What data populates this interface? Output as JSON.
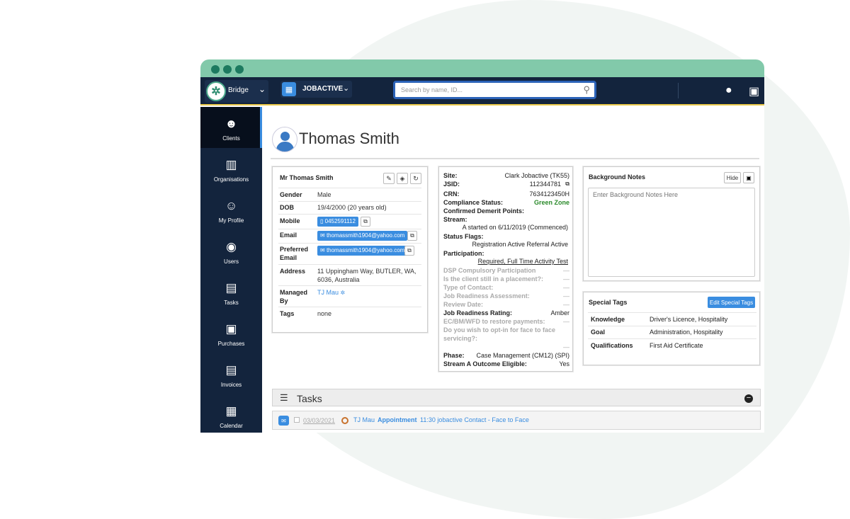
{
  "colors": {
    "titlebar": "#82c9aa",
    "nav": "#13243d",
    "accent": "#3a8de0",
    "green_zone": "#2a8a2a"
  },
  "app": {
    "brand": "Bridge",
    "program": "JOBACTIVE",
    "search_placeholder": "Search by name, ID..."
  },
  "sidebar": {
    "items": [
      {
        "label": "Clients",
        "icon": "clients-icon"
      },
      {
        "label": "Organisations",
        "icon": "building-icon"
      },
      {
        "label": "My Profile",
        "icon": "profile-icon"
      },
      {
        "label": "Users",
        "icon": "users-icon"
      },
      {
        "label": "Tasks",
        "icon": "tasks-icon"
      },
      {
        "label": "Purchases",
        "icon": "money-icon"
      },
      {
        "label": "Invoices",
        "icon": "invoice-icon"
      },
      {
        "label": "Calendar",
        "icon": "calendar-icon"
      }
    ]
  },
  "client": {
    "name": "Thomas Smith",
    "full_name": "Mr Thomas Smith",
    "details": {
      "gender_label": "Gender",
      "gender": "Male",
      "dob_label": "DOB",
      "dob": "19/4/2000 (20 years old)",
      "mobile_label": "Mobile",
      "mobile": "0452591112",
      "email_label": "Email",
      "email": "thomassmith1904@yahoo.com",
      "preferred_email_label_1": "Preferred",
      "preferred_email_label_2": "Email",
      "preferred_email": "thomassmith1904@yahoo.com",
      "address_label": "Address",
      "address_1": "11 Uppingham Way, BUTLER, WA,",
      "address_2": "6036, Australia",
      "managed_label_1": "Managed",
      "managed_label_2": "By",
      "managed_by": "TJ Mau",
      "tags_label": "Tags",
      "tags": "none"
    }
  },
  "jobactive": {
    "site_label": "Site:",
    "site": "Clark Jobactive (TK55)",
    "jsid_label": "JSID:",
    "jsid": "112344781",
    "crn_label": "CRN:",
    "crn": "7634123450H",
    "compliance_label": "Compliance Status:",
    "compliance": "Green Zone",
    "demerit_label": "Confirmed Demerit Points:",
    "stream_label": "Stream:",
    "stream": "A started on 6/11/2019 (Commenced)",
    "flags_label": "Status Flags:",
    "flags": "Registration Active Referral Active",
    "participation_label": "Participation:",
    "participation": "Required, Full Time Activity Test",
    "dsp_label": "DSP Compulsory Participation",
    "dsp": "—",
    "placement_label": "Is the client still in a placement?:",
    "placement": "—",
    "contact_label": "Type of Contact:",
    "contact": "—",
    "jra_label": "Job Readiness Assessment:",
    "jra": "—",
    "review_label": "Review Date:",
    "review": "—",
    "jrr_label": "Job Readiness Rating:",
    "jrr": "Amber",
    "ec_label": "EC/BM/WFD to restore payments:",
    "ec": "—",
    "optin_label_1": "Do you wish to opt-in for face to face",
    "optin_label_2": "servicing?:",
    "optin": "—",
    "phase_label": "Phase:",
    "phase": "Case Management (CM12) (SPI)",
    "outcome_label": "Stream A Outcome Eligible:",
    "outcome": "Yes"
  },
  "background_notes": {
    "title": "Background Notes",
    "hide_label": "Hide",
    "placeholder": "Enter Background Notes Here"
  },
  "special_tags": {
    "title": "Special Tags",
    "edit_label": "Edit Special Tags",
    "rows": [
      {
        "key": "Knowledge",
        "value": "Driver's Licence, Hospitality"
      },
      {
        "key": "Goal",
        "value": "Administration, Hospitality"
      },
      {
        "key": "Qualifications",
        "value": "First Aid Certificate"
      }
    ]
  },
  "tasks": {
    "title": "Tasks",
    "rows": [
      {
        "date": "03/03/2021",
        "user": "TJ Mau",
        "type": "Appointment",
        "description": "11:30 jobactive Contact - Face to Face"
      }
    ]
  }
}
